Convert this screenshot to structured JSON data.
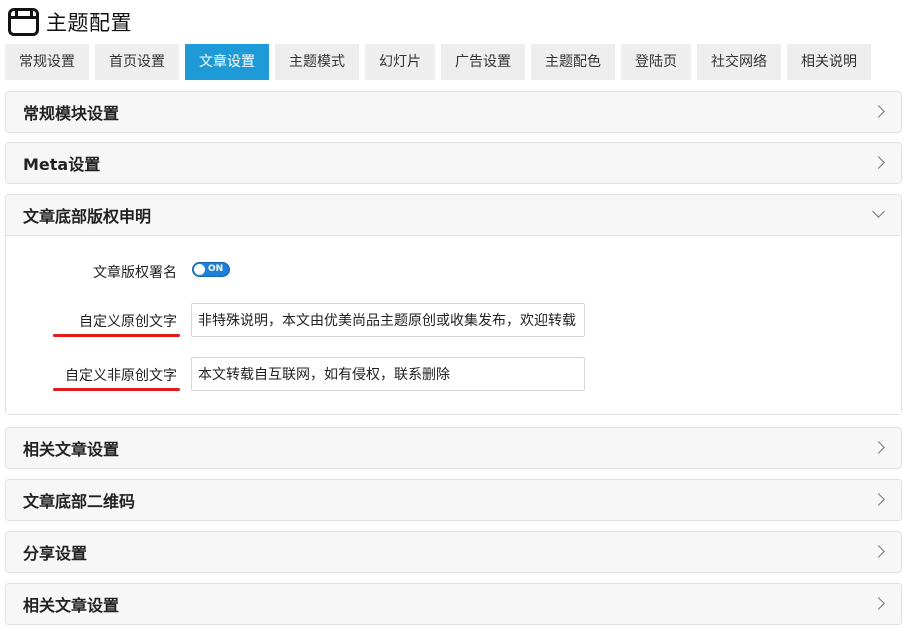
{
  "header": {
    "title": "主题配置",
    "icon": "window-icon"
  },
  "tabs": [
    {
      "label": "常规设置",
      "active": false
    },
    {
      "label": "首页设置",
      "active": false
    },
    {
      "label": "文章设置",
      "active": true
    },
    {
      "label": "主题模式",
      "active": false
    },
    {
      "label": "幻灯片",
      "active": false
    },
    {
      "label": "广告设置",
      "active": false
    },
    {
      "label": "主题配色",
      "active": false
    },
    {
      "label": "登陆页",
      "active": false
    },
    {
      "label": "社交网络",
      "active": false
    },
    {
      "label": "相关说明",
      "active": false
    }
  ],
  "sections": [
    {
      "title": "常规模块设置",
      "expanded": false
    },
    {
      "title": "Meta设置",
      "expanded": false
    },
    {
      "title": "文章底部版权申明",
      "expanded": true
    },
    {
      "title": "相关文章设置",
      "expanded": false
    },
    {
      "title": "文章底部二维码",
      "expanded": false
    },
    {
      "title": "分享设置",
      "expanded": false
    },
    {
      "title": "相关文章设置",
      "expanded": false
    }
  ],
  "copyright": {
    "signature_label": "文章版权署名",
    "signature_toggle": "ON",
    "original_label": "自定义原创文字",
    "original_value": "非特殊说明，本文由优美尚品主题原创或收集发布，欢迎转载",
    "non_original_label": "自定义非原创文字",
    "non_original_value": "本文转载自互联网，如有侵权，联系删除"
  },
  "colors": {
    "accent": "#1e9ad6",
    "underline": "#e01b1b",
    "toggle": "#1e7fd6"
  }
}
